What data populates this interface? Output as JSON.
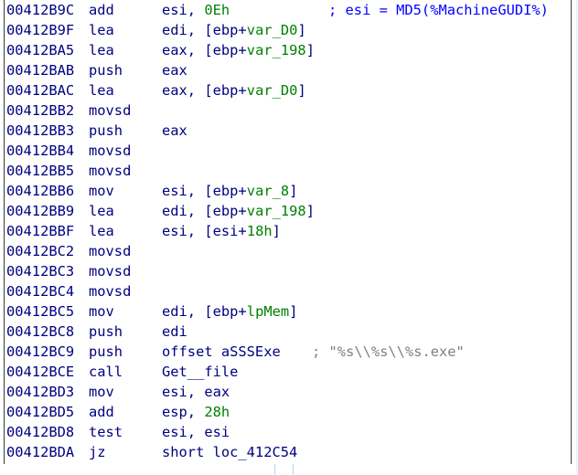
{
  "listing": [
    {
      "addr": "00412B9C",
      "mnem": "add",
      "ops": [
        {
          "t": "esi, ",
          "c": "reg"
        },
        {
          "t": "0Eh",
          "c": "num"
        }
      ],
      "comment": "; esi = MD5(%MachineGUDI%)",
      "comment_class": "comment"
    },
    {
      "addr": "00412B9F",
      "mnem": "lea",
      "ops": [
        {
          "t": "edi, [ebp+",
          "c": "reg"
        },
        {
          "t": "var_D0",
          "c": "var"
        },
        {
          "t": "]",
          "c": "reg"
        }
      ],
      "comment": "",
      "comment_class": ""
    },
    {
      "addr": "00412BA5",
      "mnem": "lea",
      "ops": [
        {
          "t": "eax, [ebp+",
          "c": "reg"
        },
        {
          "t": "var_198",
          "c": "var"
        },
        {
          "t": "]",
          "c": "reg"
        }
      ],
      "comment": "",
      "comment_class": ""
    },
    {
      "addr": "00412BAB",
      "mnem": "push",
      "ops": [
        {
          "t": "eax",
          "c": "reg"
        }
      ],
      "comment": "",
      "comment_class": ""
    },
    {
      "addr": "00412BAC",
      "mnem": "lea",
      "ops": [
        {
          "t": "eax, [ebp+",
          "c": "reg"
        },
        {
          "t": "var_D0",
          "c": "var"
        },
        {
          "t": "]",
          "c": "reg"
        }
      ],
      "comment": "",
      "comment_class": ""
    },
    {
      "addr": "00412BB2",
      "mnem": "movsd",
      "ops": [],
      "comment": "",
      "comment_class": ""
    },
    {
      "addr": "00412BB3",
      "mnem": "push",
      "ops": [
        {
          "t": "eax",
          "c": "reg"
        }
      ],
      "comment": "",
      "comment_class": ""
    },
    {
      "addr": "00412BB4",
      "mnem": "movsd",
      "ops": [],
      "comment": "",
      "comment_class": ""
    },
    {
      "addr": "00412BB5",
      "mnem": "movsd",
      "ops": [],
      "comment": "",
      "comment_class": ""
    },
    {
      "addr": "00412BB6",
      "mnem": "mov",
      "ops": [
        {
          "t": "esi, [ebp+",
          "c": "reg"
        },
        {
          "t": "var_8",
          "c": "var"
        },
        {
          "t": "]",
          "c": "reg"
        }
      ],
      "comment": "",
      "comment_class": ""
    },
    {
      "addr": "00412BB9",
      "mnem": "lea",
      "ops": [
        {
          "t": "edi, [ebp+",
          "c": "reg"
        },
        {
          "t": "var_198",
          "c": "var"
        },
        {
          "t": "]",
          "c": "reg"
        }
      ],
      "comment": "",
      "comment_class": ""
    },
    {
      "addr": "00412BBF",
      "mnem": "lea",
      "ops": [
        {
          "t": "esi, [esi+",
          "c": "reg"
        },
        {
          "t": "18h",
          "c": "num"
        },
        {
          "t": "]",
          "c": "reg"
        }
      ],
      "comment": "",
      "comment_class": ""
    },
    {
      "addr": "00412BC2",
      "mnem": "movsd",
      "ops": [],
      "comment": "",
      "comment_class": ""
    },
    {
      "addr": "00412BC3",
      "mnem": "movsd",
      "ops": [],
      "comment": "",
      "comment_class": ""
    },
    {
      "addr": "00412BC4",
      "mnem": "movsd",
      "ops": [],
      "comment": "",
      "comment_class": ""
    },
    {
      "addr": "00412BC5",
      "mnem": "mov",
      "ops": [
        {
          "t": "edi, [ebp+",
          "c": "reg"
        },
        {
          "t": "lpMem",
          "c": "var"
        },
        {
          "t": "]",
          "c": "reg"
        }
      ],
      "comment": "",
      "comment_class": ""
    },
    {
      "addr": "00412BC8",
      "mnem": "push",
      "ops": [
        {
          "t": "edi",
          "c": "reg"
        }
      ],
      "comment": "",
      "comment_class": ""
    },
    {
      "addr": "00412BC9",
      "mnem": "push",
      "ops": [
        {
          "t": "offset aSSSExe",
          "c": "sym"
        }
      ],
      "comment": "; \"%s\\\\%s\\\\%s.exe\"",
      "comment_class": "str-comment"
    },
    {
      "addr": "00412BCE",
      "mnem": "call",
      "ops": [
        {
          "t": "Get__file",
          "c": "sym"
        }
      ],
      "comment": "",
      "comment_class": ""
    },
    {
      "addr": "00412BD3",
      "mnem": "mov",
      "ops": [
        {
          "t": "esi, eax",
          "c": "reg"
        }
      ],
      "comment": "",
      "comment_class": ""
    },
    {
      "addr": "00412BD5",
      "mnem": "add",
      "ops": [
        {
          "t": "esp, ",
          "c": "reg"
        },
        {
          "t": "28h",
          "c": "num"
        }
      ],
      "comment": "",
      "comment_class": ""
    },
    {
      "addr": "00412BD8",
      "mnem": "test",
      "ops": [
        {
          "t": "esi, esi",
          "c": "reg"
        }
      ],
      "comment": "",
      "comment_class": ""
    },
    {
      "addr": "00412BDA",
      "mnem": "jz",
      "ops": [
        {
          "t": "short loc_412C54",
          "c": "sym"
        }
      ],
      "comment": "",
      "comment_class": ""
    }
  ],
  "colors": {
    "text": "#000080",
    "variable": "#008000",
    "comment": "#0000ff",
    "string_comment": "#808080",
    "border": "#3a3a3a"
  }
}
